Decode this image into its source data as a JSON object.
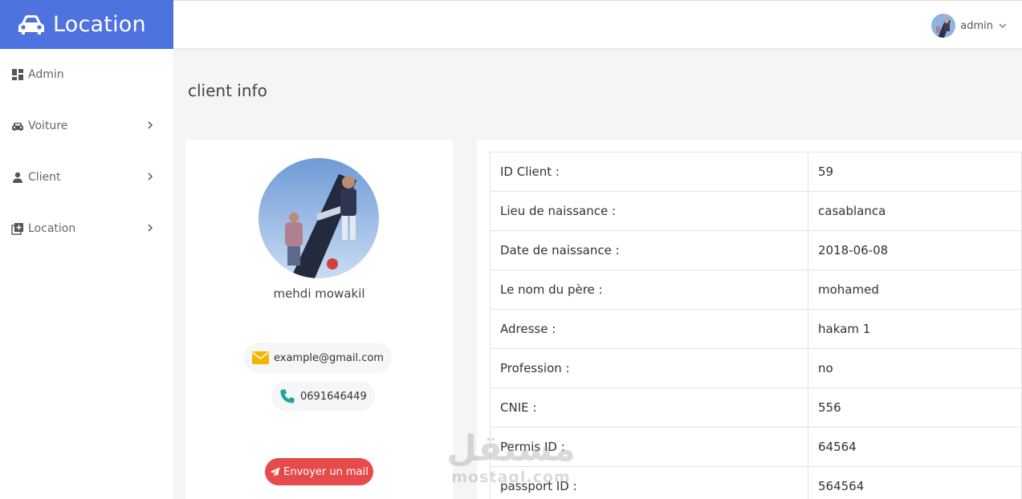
{
  "brand": {
    "title": "Location",
    "color": "#4e73df"
  },
  "topbar": {
    "user_name": "admin"
  },
  "sidebar": {
    "items": [
      {
        "label": "Admin",
        "icon": "dashboard-icon",
        "has_submenu": false
      },
      {
        "label": "Voiture",
        "icon": "car-icon",
        "has_submenu": true
      },
      {
        "label": "Client",
        "icon": "user-icon",
        "has_submenu": true
      },
      {
        "label": "Location",
        "icon": "add-box-icon",
        "has_submenu": true
      }
    ]
  },
  "page": {
    "title": "client info"
  },
  "profile": {
    "name": "mehdi mowakil",
    "email": "example@gmail.com",
    "phone": "0691646449",
    "mail_button": "Envoyer un mail",
    "mail_button_color": "#e74a4a"
  },
  "info": {
    "rows": [
      {
        "label": "ID Client :",
        "value": "59"
      },
      {
        "label": "Lieu de naissance :",
        "value": "casablanca"
      },
      {
        "label": "Date de naissance :",
        "value": "2018-06-08"
      },
      {
        "label": "Le nom du père :",
        "value": "mohamed"
      },
      {
        "label": "Adresse :",
        "value": "hakam 1"
      },
      {
        "label": "Profession :",
        "value": "no"
      },
      {
        "label": "CNIE :",
        "value": "556"
      },
      {
        "label": "Permis ID :",
        "value": "64564"
      },
      {
        "label": "passport ID :",
        "value": "564564"
      }
    ]
  },
  "watermark": {
    "arabic": "مستقل",
    "latin": "mostaql.com"
  }
}
